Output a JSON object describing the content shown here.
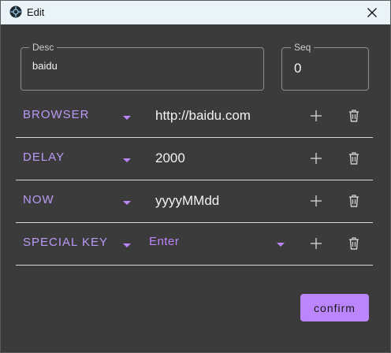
{
  "window": {
    "title": "Edit"
  },
  "desc_field": {
    "label": "Desc",
    "value": "baidu"
  },
  "seq_field": {
    "label": "Seq",
    "value": "0"
  },
  "rows": [
    {
      "type": "BROWSER",
      "value": "http://baidu.com",
      "value_kind": "text"
    },
    {
      "type": "DELAY",
      "value": "2000",
      "value_kind": "text"
    },
    {
      "type": "NOW",
      "value": "yyyyMMdd",
      "value_kind": "text"
    },
    {
      "type": "SPECIAL KEY",
      "value": "Enter",
      "value_kind": "select"
    }
  ],
  "confirm_label": "confirm",
  "colors": {
    "accent": "#bb86fc",
    "background": "#3b3b3b",
    "titlebar": "#e9f4f8"
  }
}
